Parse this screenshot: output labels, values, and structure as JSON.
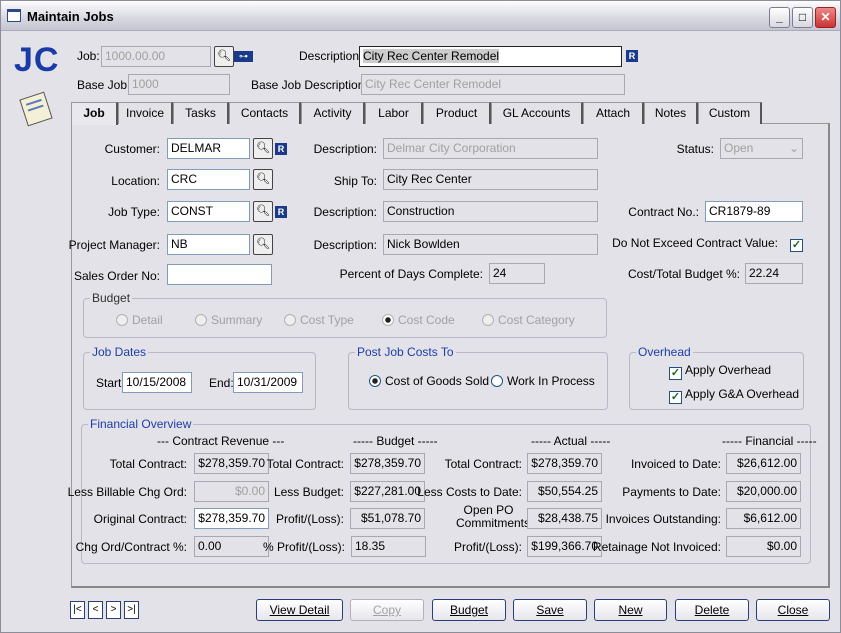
{
  "window": {
    "title": "Maintain Jobs",
    "min": "_",
    "max": "□",
    "close": "✕"
  },
  "module": {
    "code": "JC"
  },
  "header": {
    "job_label": "Job:",
    "job_value": "1000.00.00",
    "desc_label": "Description:",
    "desc_value": "City Rec Center Remodel",
    "base_job_label": "Base Job:",
    "base_job_value": "1000",
    "base_desc_label": "Base Job Description:",
    "base_desc_value": "City Rec Center Remodel"
  },
  "tabs": [
    {
      "label": "Job"
    },
    {
      "label": "Invoice"
    },
    {
      "label": "Tasks"
    },
    {
      "label": "Contacts"
    },
    {
      "label": "Activity"
    },
    {
      "label": "Labor"
    },
    {
      "label": "Product"
    },
    {
      "label": "GL Accounts"
    },
    {
      "label": "Attach"
    },
    {
      "label": "Notes"
    },
    {
      "label": "Custom"
    }
  ],
  "job": {
    "customer_label": "Customer:",
    "customer": "DELMAR",
    "customer_desc_label": "Description:",
    "customer_desc": "Delmar City Corporation",
    "status_label": "Status:",
    "status": "Open",
    "location_label": "Location:",
    "location": "CRC",
    "ship_to_label": "Ship To:",
    "ship_to": "City Rec Center",
    "job_type_label": "Job Type:",
    "job_type": "CONST",
    "job_type_desc_label": "Description:",
    "job_type_desc": "Construction",
    "contract_no_label": "Contract No.:",
    "contract_no": "CR1879-89",
    "pm_label": "Project Manager:",
    "pm": "NB",
    "pm_desc_label": "Description:",
    "pm_desc": "Nick Bowlden",
    "dnec_label": "Do Not Exceed Contract Value:",
    "dnec_checked": true,
    "so_label": "Sales Order No:",
    "so": "",
    "pct_days_label": "Percent of Days Complete:",
    "pct_days": "24",
    "cost_budget_label": "Cost/Total Budget %:",
    "cost_budget": "22.24",
    "r": "R"
  },
  "budget": {
    "title": "Budget",
    "options": [
      "Detail",
      "Summary",
      "Cost Type",
      "Cost Code",
      "Cost Category"
    ],
    "selected": "Cost Code"
  },
  "job_dates": {
    "title": "Job Dates",
    "start_label": "Start:",
    "start": "10/15/2008",
    "end_label": "End:",
    "end": "10/31/2009"
  },
  "post_costs": {
    "title": "Post Job Costs To",
    "options": [
      "Cost of Goods Sold",
      "Work In Process"
    ],
    "selected": "Cost of Goods Sold"
  },
  "overhead": {
    "title": "Overhead",
    "apply_overhead": "Apply Overhead",
    "apply_overhead_checked": true,
    "apply_ga": "Apply G&A Overhead",
    "apply_ga_checked": true
  },
  "financial": {
    "title": "Financial Overview",
    "contract": {
      "header": "--- Contract Revenue ---",
      "rows": [
        {
          "label": "Total Contract:",
          "value": "$278,359.70"
        },
        {
          "label": "Less Billable Chg Ord:",
          "value": "$0.00"
        },
        {
          "label": "Original Contract:",
          "value": "$278,359.70"
        },
        {
          "label": "Chg Ord/Contract %:",
          "value": "0.00"
        }
      ]
    },
    "budget": {
      "header": "----- Budget -----",
      "rows": [
        {
          "label": "Total Contract:",
          "value": "$278,359.70"
        },
        {
          "label": "Less Budget:",
          "value": "$227,281.00"
        },
        {
          "label": "Profit/(Loss):",
          "value": "$51,078.70"
        },
        {
          "label": "% Profit/(Loss):",
          "value": "18.35"
        }
      ]
    },
    "actual": {
      "header": "----- Actual -----",
      "rows": [
        {
          "label": "Total Contract:",
          "value": "$278,359.70"
        },
        {
          "label": "Less Costs to Date:",
          "value": "$50,554.25"
        },
        {
          "label": "Open PO Commitments:",
          "value": "$28,438.75"
        },
        {
          "label": "Profit/(Loss):",
          "value": "$199,366.70"
        }
      ]
    },
    "fin": {
      "header": "----- Financial -----",
      "rows": [
        {
          "label": "Invoiced to Date:",
          "value": "$26,612.00"
        },
        {
          "label": "Payments to Date:",
          "value": "$20,000.00"
        },
        {
          "label": "Invoices Outstanding:",
          "value": "$6,612.00"
        },
        {
          "label": "Retainage Not Invoiced:",
          "value": "$0.00"
        }
      ]
    }
  },
  "nav": {
    "first": "|<",
    "prev": "<",
    "next": ">",
    "last": ">|"
  },
  "buttons": {
    "view_detail": "View Detail",
    "copy": "Copy",
    "budget": "Budget",
    "save": "Save",
    "new": "New",
    "delete": "Delete",
    "close": "Close"
  }
}
